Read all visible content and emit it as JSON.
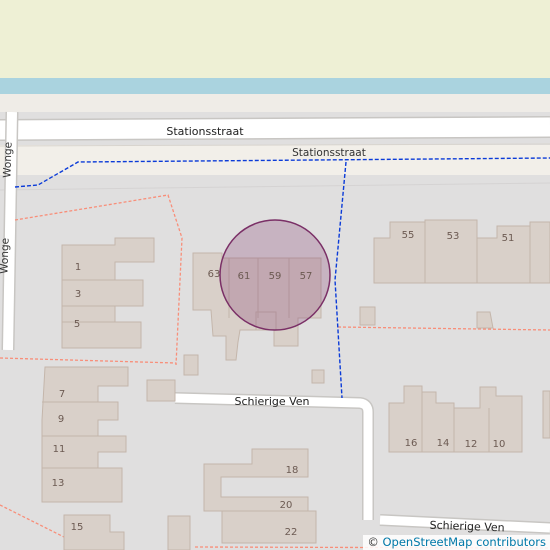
{
  "map": {
    "streets": {
      "stationsstraat_main": "Stationsstraat",
      "stationsstraat_service": "Stationsstraat",
      "wonge": "Wonge",
      "schierige_ven": "Schierige Ven",
      "schierige_ven_south": "Schierige Ven"
    },
    "house_numbers": [
      "63",
      "61",
      "59",
      "57",
      "55",
      "53",
      "51",
      "1",
      "3",
      "5",
      "7",
      "9",
      "11",
      "13",
      "15",
      "16",
      "14",
      "12",
      "10",
      "18",
      "20",
      "22"
    ],
    "colors": {
      "landuse": "#e0dfdf",
      "farmland": "#eef0d5",
      "water": "#aad3df",
      "road": "#ffffff",
      "road_casing": "#c8c6c3",
      "building": "#d9d0c9",
      "building_outline": "#c4b6ab",
      "footpath": "#0b3bd8",
      "boundary": "#f88e79",
      "highlight_fill": "#8a3f74",
      "highlight_stroke": "#7a2f66"
    },
    "highlight": "circle-over-59"
  },
  "attribution": {
    "symbol": "©",
    "text": "OpenStreetMap contributors"
  }
}
